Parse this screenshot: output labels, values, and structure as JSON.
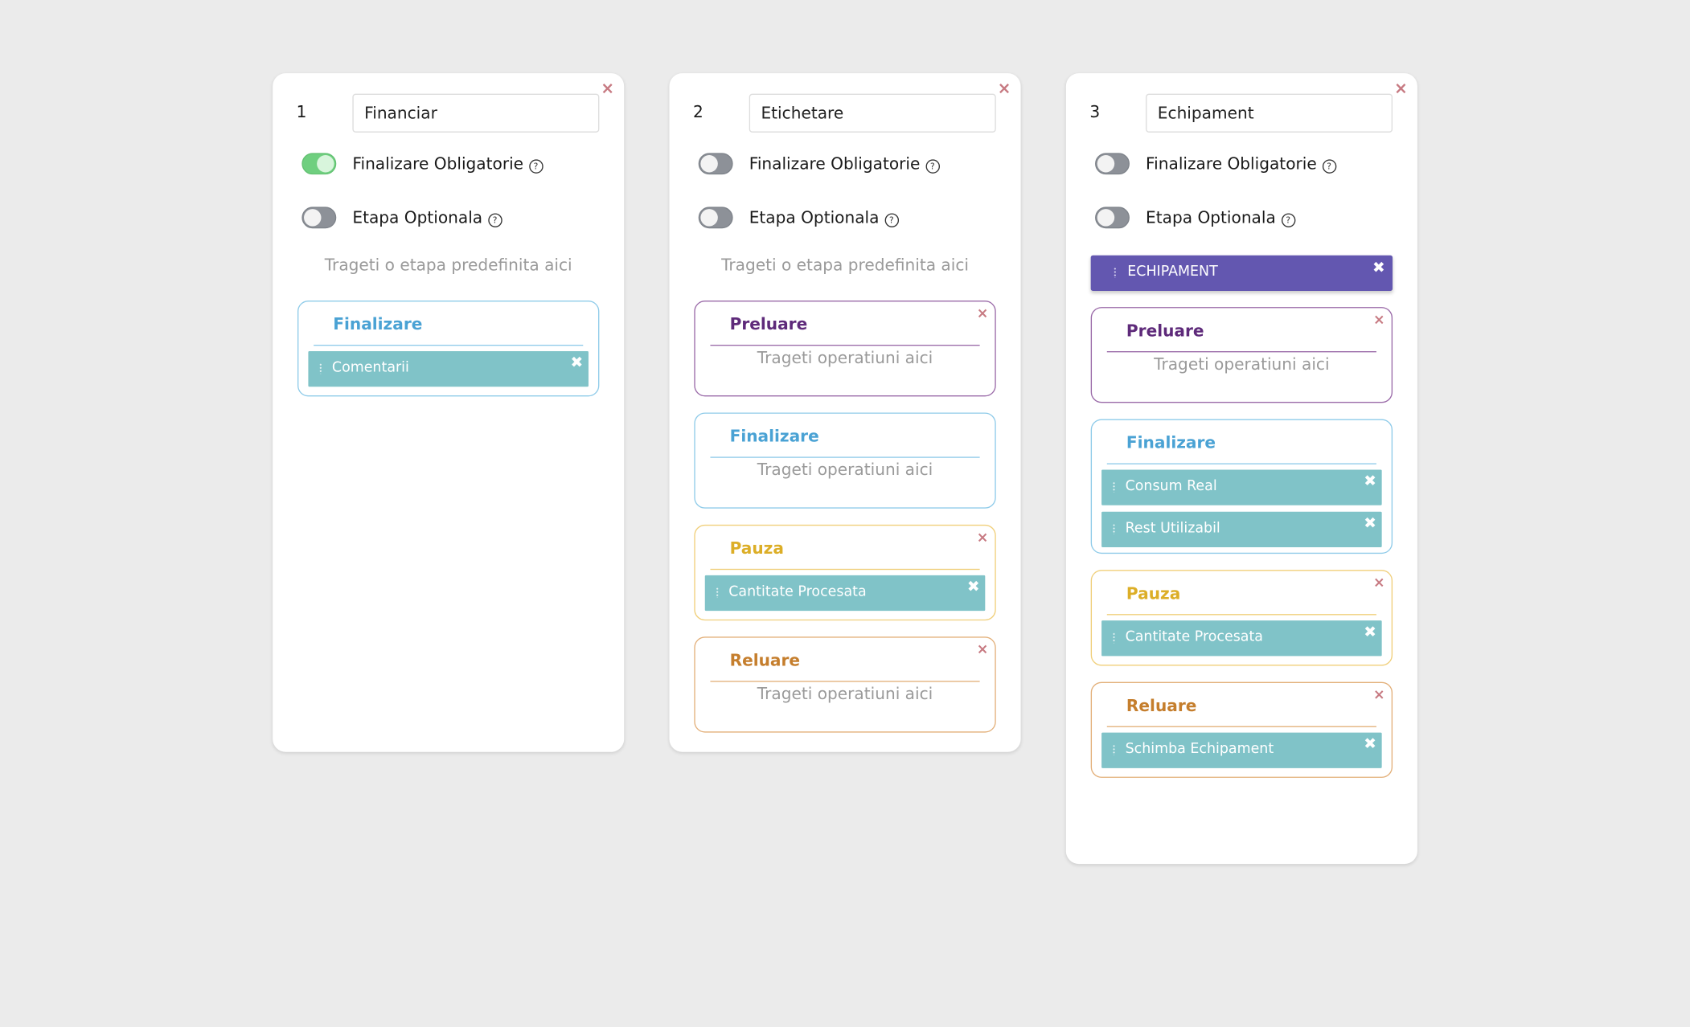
{
  "common": {
    "finalizare_obligatorie": "Finalizare Obligatorie",
    "etapa_optionala": "Etapa Optionala",
    "help_glyph": "?",
    "drop_stage_hint": "Trageti o etapa predefinita aici",
    "drop_operations_hint": "Trageti operatiuni aici",
    "close_glyph": "×",
    "remove_glyph": "✖",
    "group_names": {
      "preluare": "Preluare",
      "finalizare": "Finalizare",
      "pauza": "Pauza",
      "reluare": "Reluare"
    }
  },
  "colors": {
    "finalizare": "#4aa2d4",
    "preluare": "#5e2a7a",
    "pauza": "#dcae27",
    "reluare": "#c57e2d",
    "operation_tag": "#80c3c8",
    "preset_tag": "#6357b0",
    "toggle_on": "#6fcf7f"
  },
  "cards": [
    {
      "number": "1",
      "name": "Financiar",
      "finalizare_obligatorie_on": true,
      "etapa_optionala_on": false,
      "finalizare_ops": [
        "Comentarii"
      ]
    },
    {
      "number": "2",
      "name": "Etichetare",
      "finalizare_obligatorie_on": false,
      "etapa_optionala_on": false,
      "pauza_ops": [
        "Cantitate Procesata"
      ]
    },
    {
      "number": "3",
      "name": "Echipament",
      "finalizare_obligatorie_on": false,
      "etapa_optionala_on": false,
      "preset": "ECHIPAMENT",
      "finalizare_ops": [
        "Consum Real",
        "Rest Utilizabil"
      ],
      "pauza_ops": [
        "Cantitate Procesata"
      ],
      "reluare_ops": [
        "Schimba Echipament"
      ]
    }
  ]
}
